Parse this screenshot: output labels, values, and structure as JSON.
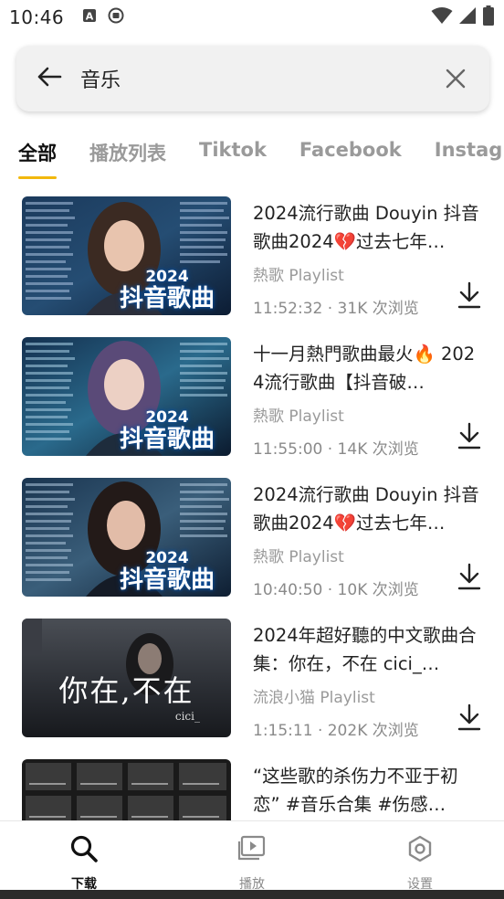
{
  "status_bar": {
    "time": "10:46"
  },
  "search": {
    "query": "音乐"
  },
  "tabs": [
    {
      "label": "全部"
    },
    {
      "label": "播放列表"
    },
    {
      "label": "Tiktok"
    },
    {
      "label": "Facebook"
    },
    {
      "label": "Instagram"
    }
  ],
  "items": [
    {
      "title": "2024流行歌曲 Douyin 抖音歌曲2024💔过去七年…",
      "channel": "熱歌 Playlist",
      "meta": "11:52:32 · 31K 次浏览",
      "cover_year": "2024",
      "cover_text": "抖音歌曲"
    },
    {
      "title": "十一月熱門歌曲最火🔥 2024流行歌曲【抖音破…",
      "channel": "熱歌 Playlist",
      "meta": "11:55:00 · 14K 次浏览",
      "cover_year": "2024",
      "cover_text": "抖音歌曲"
    },
    {
      "title": "2024流行歌曲 Douyin 抖音歌曲2024💔过去七年…",
      "channel": "熱歌 Playlist",
      "meta": "10:40:50 · 10K 次浏览",
      "cover_year": "2024",
      "cover_text": "抖音歌曲"
    },
    {
      "title": "2024年超好聽的中文歌曲合集：你在，不在 cici_…",
      "channel": "流浪小猫 Playlist",
      "meta": "1:15:11 · 202K 次浏览",
      "cover_text": "你在,不在",
      "cover_sub": "cici_"
    },
    {
      "title": "“这些歌的杀伤力不亚于初恋” #音乐合集 #伤感…",
      "channel": "",
      "meta": ""
    }
  ],
  "bottom_nav": [
    {
      "label": "下载",
      "icon": "search-icon"
    },
    {
      "label": "播放",
      "icon": "play-icon"
    },
    {
      "label": "设置",
      "icon": "gear-icon"
    }
  ],
  "colors": {
    "accent": "#f2b80d"
  }
}
